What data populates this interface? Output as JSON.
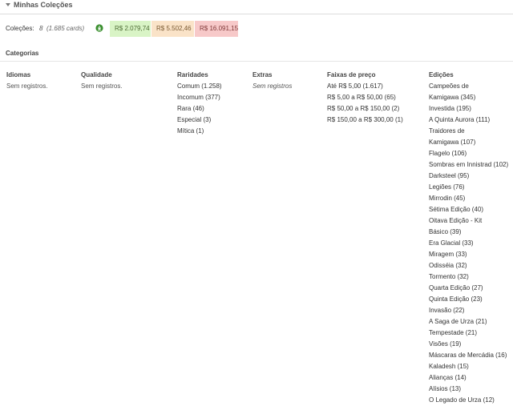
{
  "header": {
    "title": "Minhas Coleções"
  },
  "colecoes": {
    "label": "Coleções:",
    "count": "8",
    "cards": "(1.685 cards)",
    "badges": {
      "green": "R$ 2.079,74",
      "orange": "R$ 5.502,46",
      "red": "R$ 16.091,15"
    },
    "colors": {
      "green": "#d9f4c6",
      "orange": "#fae3c8",
      "red": "#f7c9c9"
    }
  },
  "categorias": {
    "title": "Categorias",
    "idiomas": {
      "header": "Idiomas",
      "empty": "Sem registros."
    },
    "qualidade": {
      "header": "Qualidade",
      "empty": "Sem registros."
    },
    "raridades": {
      "header": "Raridades",
      "items": [
        "Comum (1.258)",
        "Incomum (377)",
        "Rara (46)",
        "Especial (3)",
        "Mítica (1)"
      ]
    },
    "extras": {
      "header": "Extras",
      "empty": "Sem registros"
    },
    "faixas": {
      "header": "Faixas de preço",
      "items": [
        "Até R$ 5,00 (1.617)",
        "R$ 5,00 a R$ 50,00 (65)",
        "R$ 50,00 a R$ 150,00 (2)",
        "R$ 150,00 a R$ 300,00 (1)"
      ]
    },
    "edicoes": {
      "header": "Edições",
      "items": [
        "Campeões de",
        "Kamigawa (345)",
        "Investida (195)",
        "A Quinta Aurora (111)",
        "Traidores de",
        "Kamigawa (107)",
        "Flagelo (106)",
        "Sombras em Innistrad (102)",
        "Darksteel (95)",
        "Legiões (76)",
        "Mirrodin (45)",
        "Sétima Edição (40)",
        "Oitava Edição - Kit",
        "Básico (39)",
        "Era Glacial (33)",
        "Miragem (33)",
        "Odisséia (32)",
        "Tormento (32)",
        "Quarta Edição (27)",
        "Quinta Edição (23)",
        "Invasão (22)",
        "A Saga de Urza (21)",
        "Tempestade (21)",
        "Visões (19)",
        "Máscaras de Mercádia (16)",
        "Kaladesh (15)",
        "Alianças (14)",
        "Alísios (13)",
        "O Legado de Urza (12)"
      ]
    }
  }
}
